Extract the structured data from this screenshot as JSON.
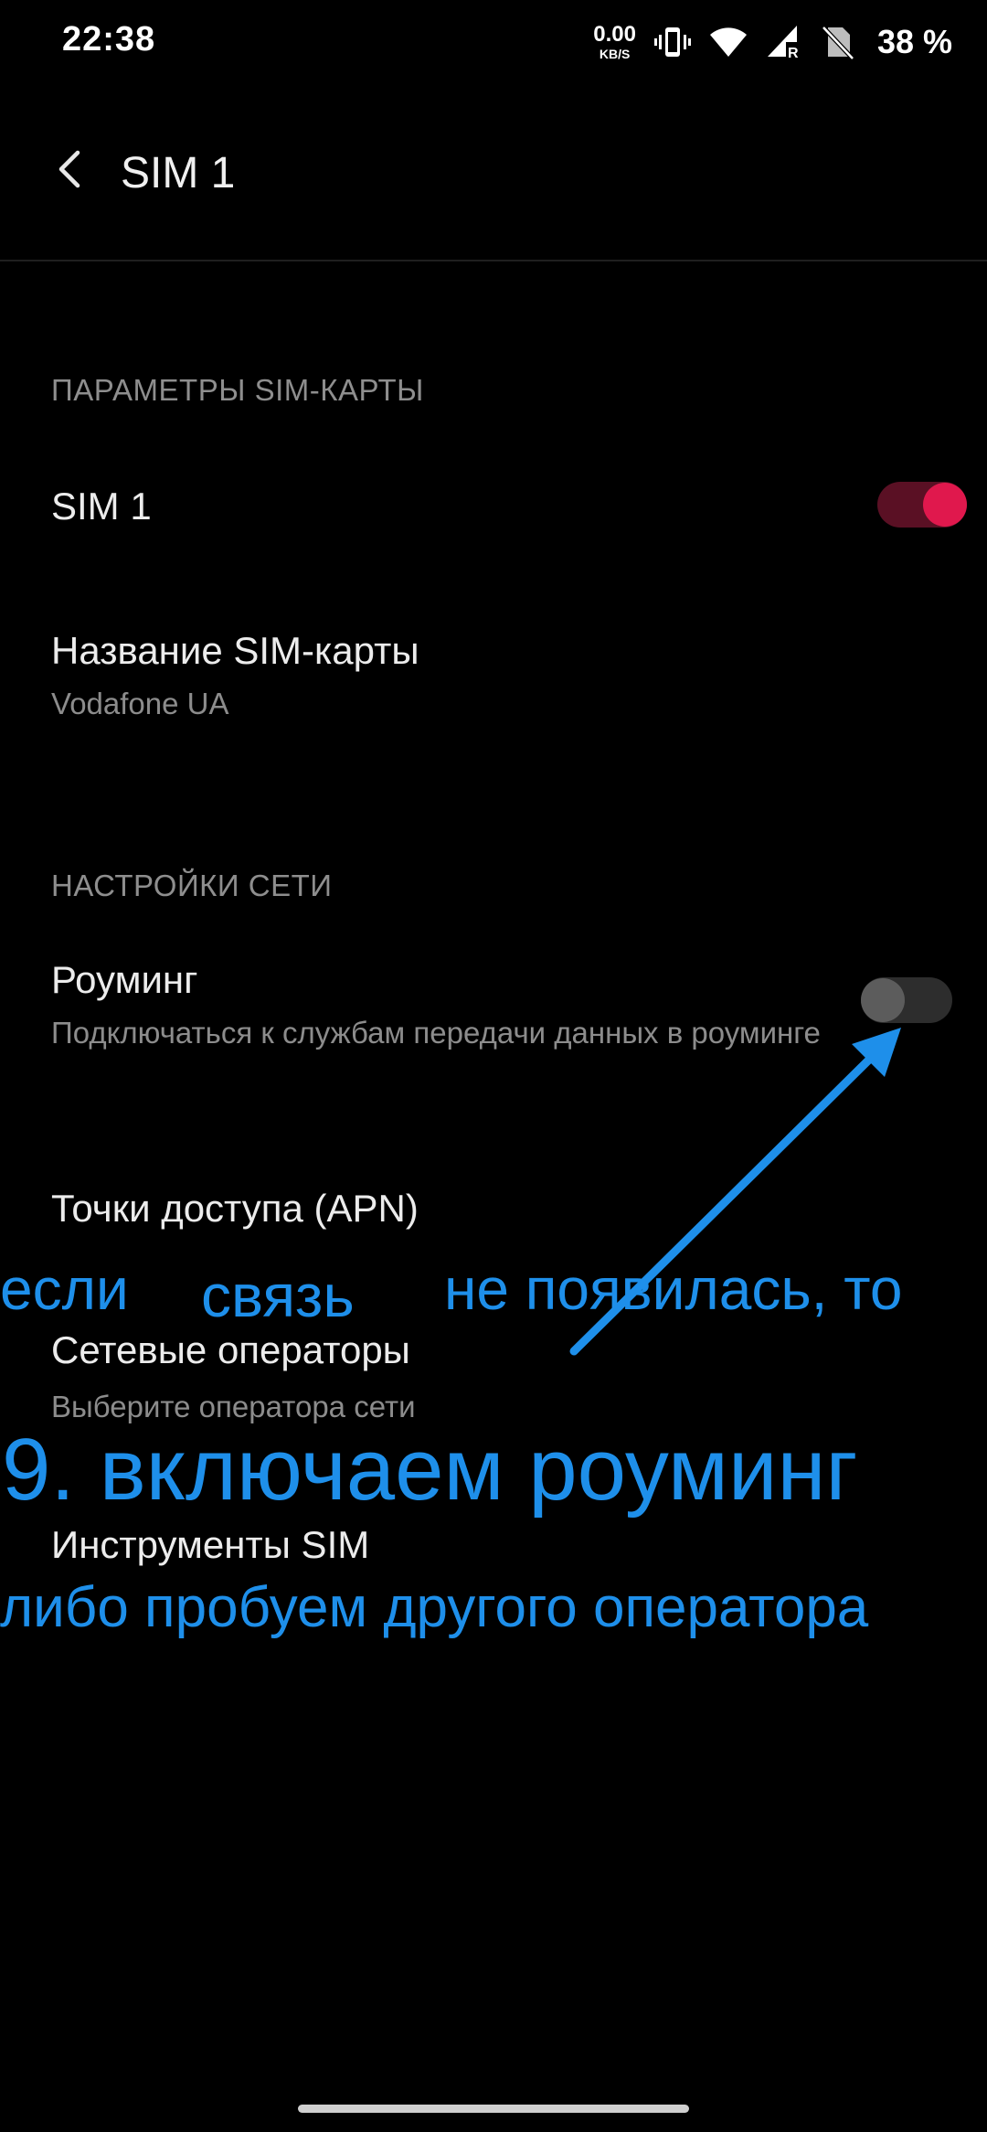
{
  "status_bar": {
    "time": "22:38",
    "net_speed_value": "0.00",
    "net_speed_unit": "KB/S",
    "battery": "38 %",
    "icons": [
      "vibrate-icon",
      "wifi-icon",
      "signal-roaming-icon",
      "no-sim-icon"
    ]
  },
  "app_bar": {
    "title": "SIM 1",
    "back_icon": "chevron-left-icon"
  },
  "sections": {
    "sim_params_header": "ПАРАМЕТРЫ SIM-КАРТЫ",
    "network_header": "НАСТРОЙКИ СЕТИ"
  },
  "items": {
    "sim_toggle": {
      "title": "SIM 1",
      "enabled": true
    },
    "sim_name": {
      "title": "Название SIM-карты",
      "summary": "Vodafone UA"
    },
    "roaming": {
      "title": "Роуминг",
      "summary": "Подключаться к службам передачи данных в роуминге",
      "enabled": false
    },
    "apn": {
      "title": "Точки доступа (APN)"
    },
    "operators": {
      "title": "Сетевые операторы",
      "summary": "Выберите оператора сети"
    },
    "sim_tools": {
      "title": "Инструменты SIM"
    }
  },
  "annotations": {
    "word1": "если",
    "word2": "связь",
    "word3": "не появилась, то",
    "main": "9. включаем роуминг",
    "bottom": "либо пробуем другого оператора",
    "color": "#1e8fea"
  },
  "colors": {
    "background": "#000000",
    "accent": "#e0184d"
  }
}
